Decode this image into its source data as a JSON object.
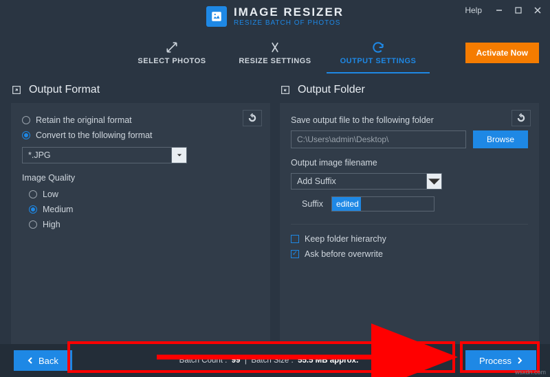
{
  "app": {
    "title": "IMAGE RESIZER",
    "subtitle": "RESIZE BATCH OF PHOTOS",
    "help_label": "Help"
  },
  "tabs": {
    "select": "SELECT PHOTOS",
    "resize": "RESIZE SETTINGS",
    "output": "OUTPUT SETTINGS"
  },
  "activate_label": "Activate Now",
  "left": {
    "heading": "Output Format",
    "retain_label": "Retain the original format",
    "convert_label": "Convert to the following format",
    "format_value": "*.JPG",
    "quality_heading": "Image Quality",
    "quality": {
      "low": "Low",
      "medium": "Medium",
      "high": "High"
    }
  },
  "right": {
    "heading": "Output Folder",
    "save_label": "Save output file to the following folder",
    "path_value": "C:\\Users\\admin\\Desktop\\",
    "browse_label": "Browse",
    "filename_label": "Output image filename",
    "filename_mode": "Add Suffix",
    "suffix_label": "Suffix",
    "suffix_value": "edited",
    "keep_hierarchy": "Keep folder hierarchy",
    "ask_overwrite": "Ask before overwrite"
  },
  "footer": {
    "back": "Back",
    "process": "Process",
    "batch_count_label": "Batch Count :",
    "batch_count": "99",
    "batch_size_label": "Batch Size :",
    "batch_size": "55.5 MB approx."
  },
  "watermark": "wsxdn.com"
}
